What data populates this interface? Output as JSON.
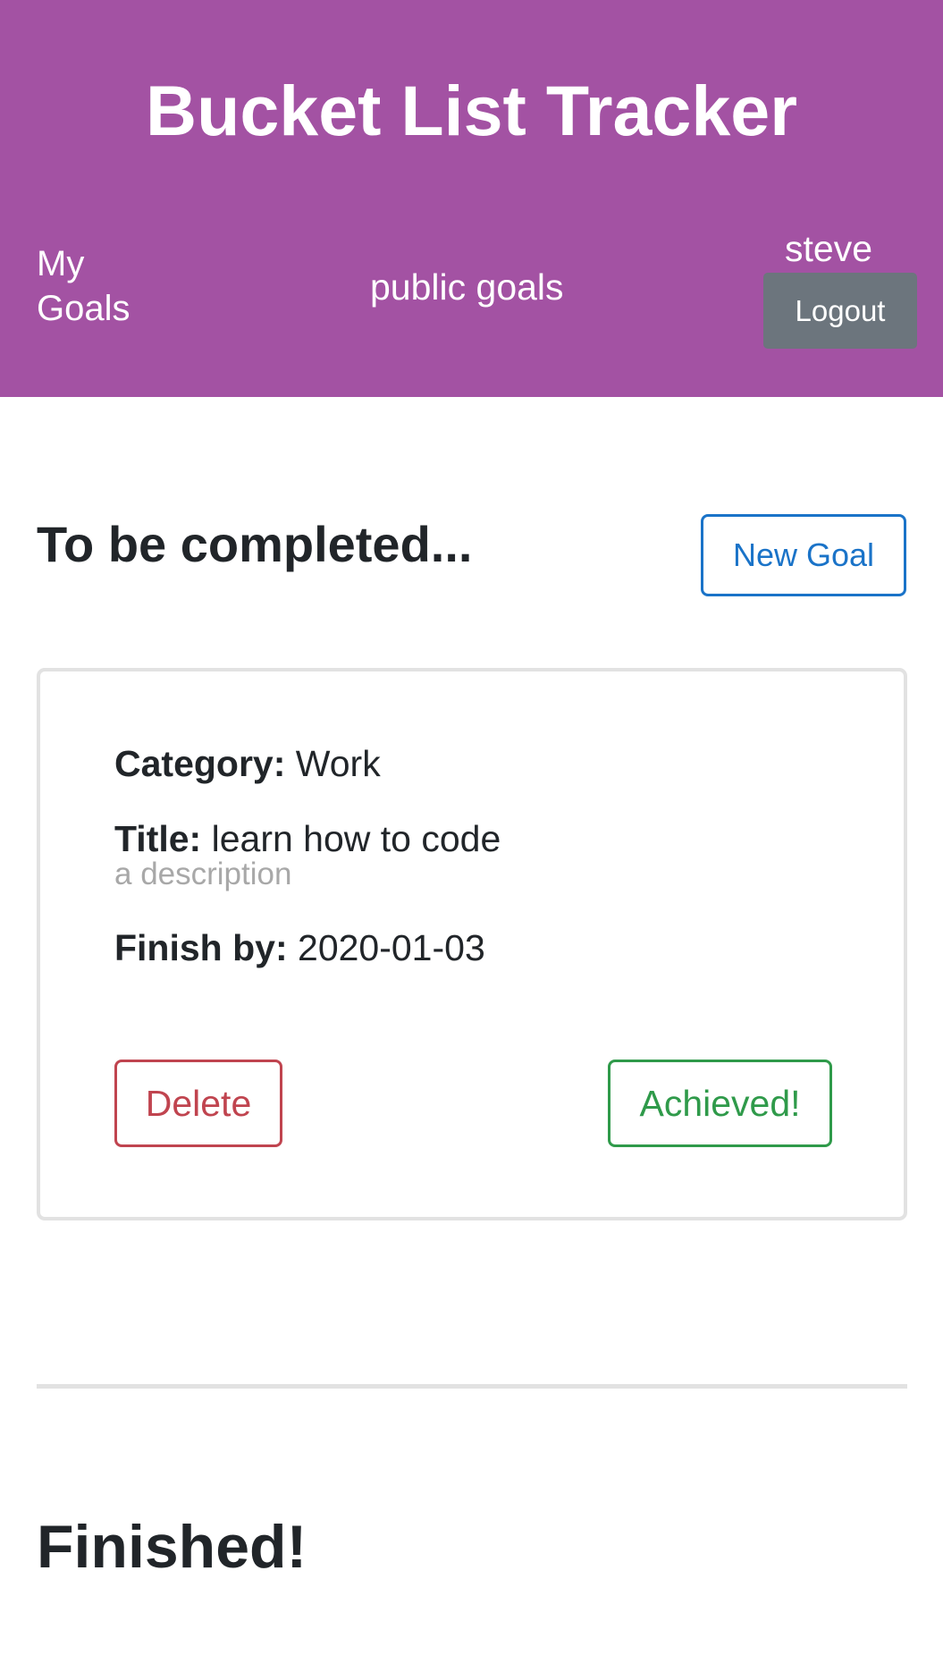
{
  "header": {
    "app_title": "Bucket List Tracker",
    "nav": {
      "my_goals": "My Goals",
      "public_goals": "public goals"
    },
    "user": {
      "username": "steve",
      "logout_label": "Logout"
    },
    "background_color": "#a352a3"
  },
  "main": {
    "pending_section_title": "To be completed...",
    "new_goal_label": "New Goal",
    "goals": [
      {
        "category_label": "Category:",
        "category": "Work",
        "title_label": "Title:",
        "title": "learn how to code",
        "description": "a description",
        "finish_label": "Finish by:",
        "finish_by": "2020-01-03",
        "delete_label": "Delete",
        "achieved_label": "Achieved!"
      }
    ],
    "finished_section_title": "Finished!"
  },
  "colors": {
    "primary": "#1a73c8",
    "danger": "#c0444f",
    "success": "#2f9a4a",
    "secondary": "#6c757d"
  }
}
